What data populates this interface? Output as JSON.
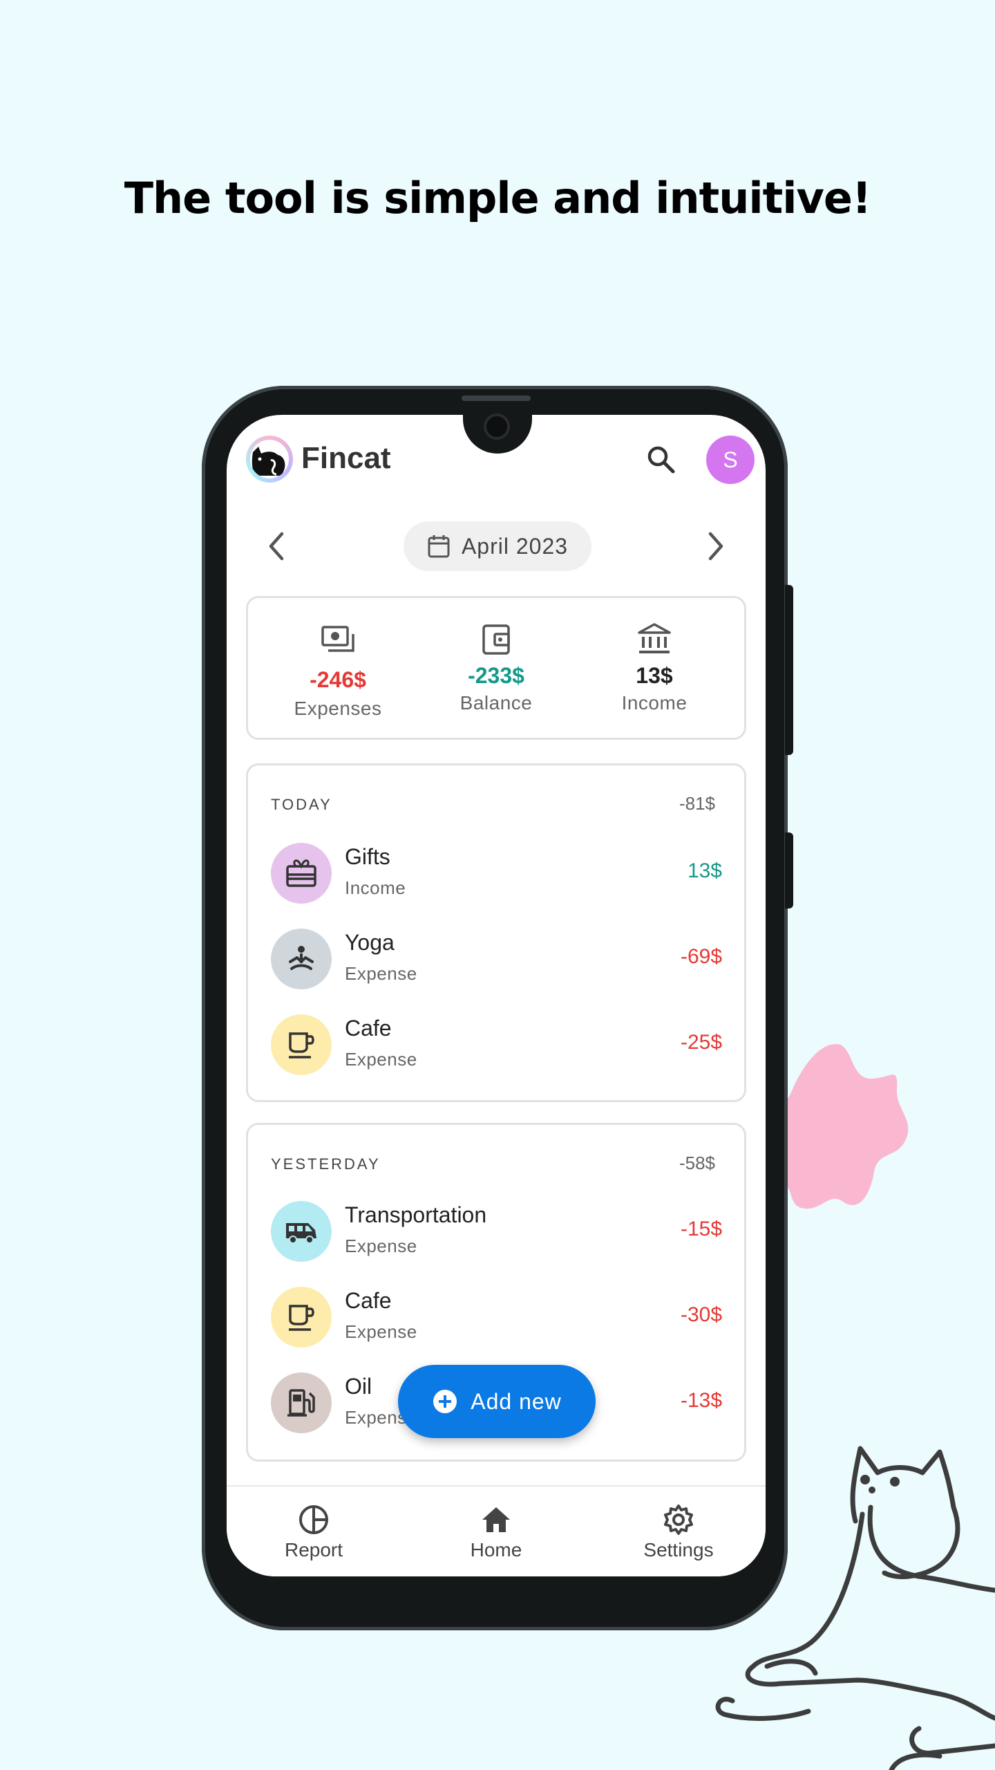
{
  "headline": "The tool is simple and intuitive!",
  "colors": {
    "background": "#ecfbfe",
    "expense": "#e53935",
    "income": "#14998a",
    "accent": "#0b7ae5",
    "avatar": "#d376f0",
    "blob": "#f9b8d0"
  },
  "app": {
    "title": "Fincat",
    "logo_icon": "cat-logo-icon",
    "avatar_initial": "S"
  },
  "month_selector": {
    "label": "April 2023",
    "prev_icon": "chevron-left-icon",
    "next_icon": "chevron-right-icon"
  },
  "summary": {
    "expenses": {
      "value": "-246$",
      "label": "Expenses",
      "icon": "cash-icon"
    },
    "balance": {
      "value": "-233$",
      "label": "Balance",
      "icon": "wallet-icon"
    },
    "income": {
      "value": "13$",
      "label": "Income",
      "icon": "bank-icon"
    }
  },
  "days": [
    {
      "title": "TODAY",
      "total": "-81$",
      "transactions": [
        {
          "name": "Gifts",
          "type": "Income",
          "amount": "13$",
          "icon": "gift-icon"
        },
        {
          "name": "Yoga",
          "type": "Expense",
          "amount": "-69$",
          "icon": "yoga-icon"
        },
        {
          "name": "Cafe",
          "type": "Expense",
          "amount": "-25$",
          "icon": "coffee-icon"
        }
      ]
    },
    {
      "title": "YESTERDAY",
      "total": "-58$",
      "transactions": [
        {
          "name": "Transportation",
          "type": "Expense",
          "amount": "-15$",
          "icon": "van-icon"
        },
        {
          "name": "Cafe",
          "type": "Expense",
          "amount": "-30$",
          "icon": "coffee-icon"
        },
        {
          "name": "Oil",
          "type": "Expense",
          "amount": "-13$",
          "icon": "fuel-icon"
        }
      ]
    }
  ],
  "fab": {
    "label": "Add new",
    "icon": "plus-circle-icon"
  },
  "bottom_nav": [
    {
      "label": "Report",
      "icon": "pie-chart-icon"
    },
    {
      "label": "Home",
      "icon": "home-icon"
    },
    {
      "label": "Settings",
      "icon": "gear-icon"
    }
  ]
}
